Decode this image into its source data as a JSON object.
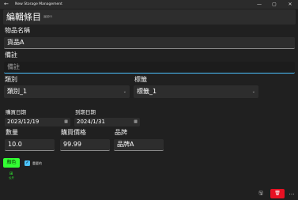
{
  "titlebar": {
    "title": "New Storage Management",
    "back_icon": "←",
    "minimize_icon": "—",
    "maximize_icon": "▢",
    "close_icon": "✕"
  },
  "header": {
    "title": "編輯條目",
    "subtitle": "返回01"
  },
  "item_name": {
    "label": "物品名稱",
    "value": "貨品A"
  },
  "notes": {
    "label": "備註",
    "placeholder": "備註"
  },
  "category": {
    "label": "類別",
    "value": "類別_1",
    "chevron": "⌄"
  },
  "tag": {
    "label": "標籤",
    "value": "標籤_1",
    "chevron": "⌄"
  },
  "purchase_date": {
    "label": "購買日期",
    "value": "2023/12/19",
    "icon": "▦"
  },
  "expiry_date": {
    "label": "到期日期",
    "value": "2024/1/31",
    "icon": "▦"
  },
  "quantity": {
    "label": "數量",
    "value": "10.0"
  },
  "price": {
    "label": "購買價格",
    "value": "99.99"
  },
  "brand": {
    "label": "品牌",
    "value": "品牌A"
  },
  "color_button": {
    "label": "顏色",
    "color": "#33ff33"
  },
  "important": {
    "label": "重要的",
    "checked": true,
    "check_glyph": "✓"
  },
  "item_icon": {
    "glyph": "⊞",
    "label": "公斤"
  },
  "bottom_bar": {
    "save_icon": "🖫",
    "delete_icon": "🗑",
    "more_icon": "…",
    "delete_color": "#e81123"
  },
  "colors": {
    "accent": "#4cc2ff",
    "background": "#202020",
    "field": "#2d2d2d"
  }
}
